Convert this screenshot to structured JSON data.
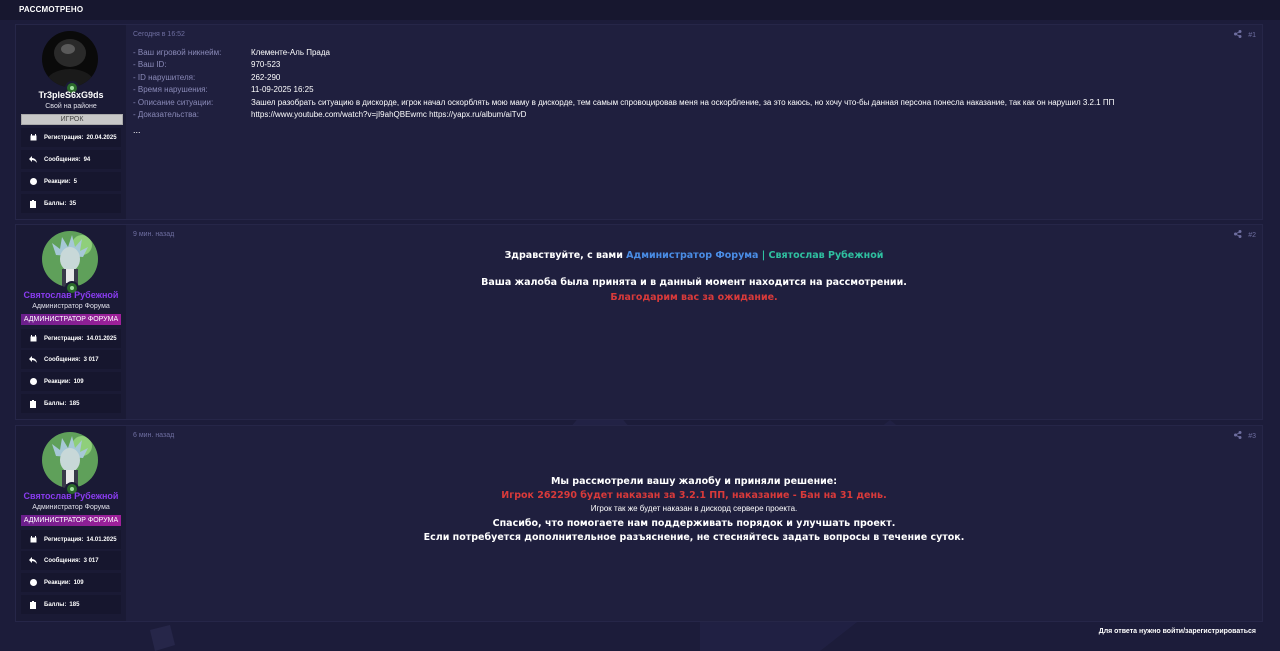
{
  "thread_status": "РАССМОТРЕНО",
  "posts": [
    {
      "number": "#1",
      "date": "Сегодня в 16:52",
      "author": {
        "name": "Tr3pleS6xG9ds",
        "title": "Свой на районе",
        "banner": "ИГРОК",
        "stats": [
          {
            "label": "Регистрация:",
            "value": "20.04.2025",
            "icon": "calendar-icon"
          },
          {
            "label": "Сообщения:",
            "value": "94",
            "icon": "reply-icon"
          },
          {
            "label": "Реакции:",
            "value": "5",
            "icon": "smile-icon"
          },
          {
            "label": "Баллы:",
            "value": "35",
            "icon": "clipboard-icon"
          }
        ]
      },
      "fields": [
        {
          "key": "- Ваш игровой никнейм:",
          "value": "Клементе-Аль Прада"
        },
        {
          "key": "- Ваш ID:",
          "value": "970-523"
        },
        {
          "key": "- ID нарушителя:",
          "value": "262-290"
        },
        {
          "key": "- Время нарушения:",
          "value": "11-09-2025 16:25"
        },
        {
          "key": "- Описание ситуации:",
          "value": "Зашел разобрать ситуацию в дискорде, игрок начал оскорблять мою маму в дискорде, тем самым спровоцировав меня на оскорбление, за это каюсь, но хочу что-бы данная персона понесла наказание, так как он нарушил 3.2.1 ПП"
        },
        {
          "key": "- Доказательства:",
          "value": "https://www.youtube.com/watch?v=jI9ahQBEwmc https://yapx.ru/album/aiTvD"
        }
      ],
      "ellipsis": "..."
    },
    {
      "number": "#2",
      "date": "9 мин. назад",
      "author": {
        "name": "Святослав Рубежной",
        "title": "Администратор Форума",
        "banner": "АДМИНИСТРАТОР ФОРУМА",
        "stats": [
          {
            "label": "Регистрация:",
            "value": "14.01.2025",
            "icon": "calendar-icon"
          },
          {
            "label": "Сообщения:",
            "value": "3 017",
            "icon": "reply-icon"
          },
          {
            "label": "Реакции:",
            "value": "109",
            "icon": "smile-icon"
          },
          {
            "label": "Баллы:",
            "value": "185",
            "icon": "clipboard-icon"
          }
        ]
      },
      "greeting_prefix": "Здравствуйте, с вами ",
      "greeting_role": "Администратор Форума",
      "greeting_sep": " | ",
      "greeting_name": "Святослав Рубежной",
      "line_review": "Ваша жалоба была принята и в данный момент находится на рассмотрении.",
      "line_thanks": "Благодарим вас за ожидание."
    },
    {
      "number": "#3",
      "date": "6 мин. назад",
      "author": {
        "name": "Святослав Рубежной",
        "title": "Администратор Форума",
        "banner": "АДМИНИСТРАТОР ФОРУМА",
        "stats": [
          {
            "label": "Регистрация:",
            "value": "14.01.2025",
            "icon": "calendar-icon"
          },
          {
            "label": "Сообщения:",
            "value": "3 017",
            "icon": "reply-icon"
          },
          {
            "label": "Реакции:",
            "value": "109",
            "icon": "smile-icon"
          },
          {
            "label": "Баллы:",
            "value": "185",
            "icon": "clipboard-icon"
          }
        ]
      },
      "line_decision": "Мы рассмотрели вашу жалобу и приняли решение:",
      "line_punish": "Игрок 262290 будет наказан за 3.2.1 ПП, наказание - Бан на 31 день.",
      "line_discord": "Игрок так же будет наказан в дискорд сервере проекта.",
      "line_thanks": "Спасибо, что помогаете нам поддерживать порядок и улучшать проект.",
      "line_questions": "Если потребуется дополнительное разъяснение, не стесняйтесь задать вопросы в течение суток."
    }
  ],
  "footer_note": "Для ответа нужно войти/зарегистрироваться",
  "colors": {
    "accent_blue": "#4a8de6",
    "accent_teal": "#2fc0a0",
    "accent_red": "#d93a3a",
    "admin_purple": "#8a3cf0"
  }
}
